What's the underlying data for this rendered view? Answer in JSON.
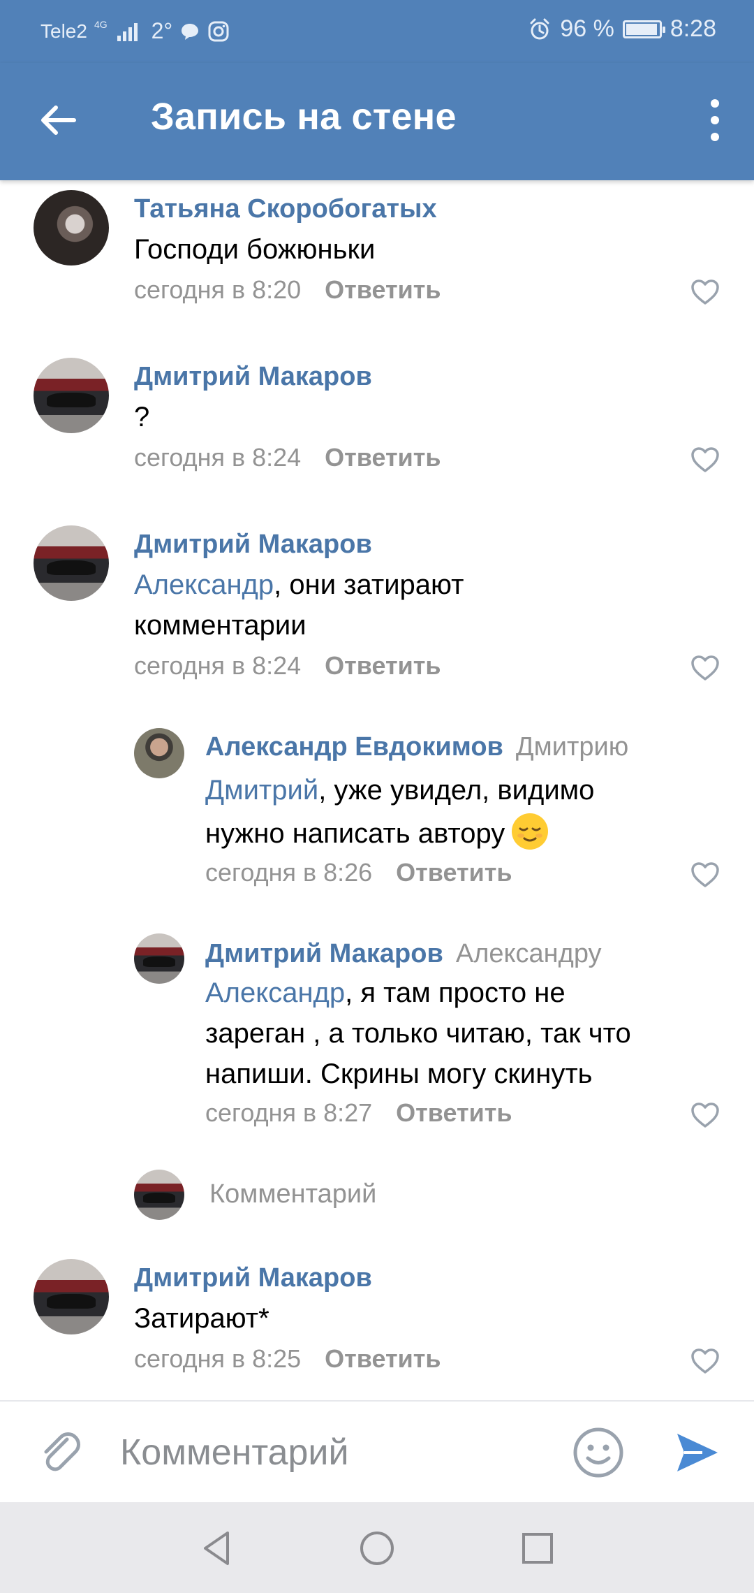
{
  "status_bar": {
    "carrier": "Tele2",
    "network": "4G",
    "temperature": "2°",
    "battery": "96 %",
    "battery_level": 0.96,
    "time": "8:28"
  },
  "header": {
    "title": "Запись на стене"
  },
  "comments": [
    {
      "author": "Татьяна Скоробогатых",
      "text": "Господи божюньки",
      "time": "сегодня в 8:20",
      "reply_label": "Ответить"
    },
    {
      "author": "Дмитрий Макаров",
      "text": "?",
      "time": "сегодня в 8:24",
      "reply_label": "Ответить"
    },
    {
      "author": "Дмитрий Макаров",
      "mention": "Александр",
      "text_line1": ", они затирают",
      "text_line2": "комментарии",
      "time": "сегодня в 8:24",
      "reply_label": "Ответить"
    },
    {
      "author": "Александр Евдокимов",
      "reply_to": "Дмитрию",
      "mention": "Дмитрий",
      "text_line1": ", уже увидел, видимо",
      "text_line2": "нужно написать автору",
      "time": "сегодня в 8:26",
      "reply_label": "Ответить"
    },
    {
      "author": "Дмитрий Макаров",
      "reply_to": "Александру",
      "mention": "Александр",
      "text_line1": ", я там просто не",
      "text_line2": "зареган , а только читаю, так что",
      "text_line3": "напиши. Скрины могу скинуть",
      "time": "сегодня в 8:27",
      "reply_label": "Ответить"
    },
    {
      "author": "Дмитрий Макаров",
      "text": "Затирают*",
      "time": "сегодня в 8:25",
      "reply_label": "Ответить"
    }
  ],
  "thread_reply": {
    "placeholder": "Комментарий"
  },
  "composer": {
    "placeholder": "Комментарий"
  }
}
